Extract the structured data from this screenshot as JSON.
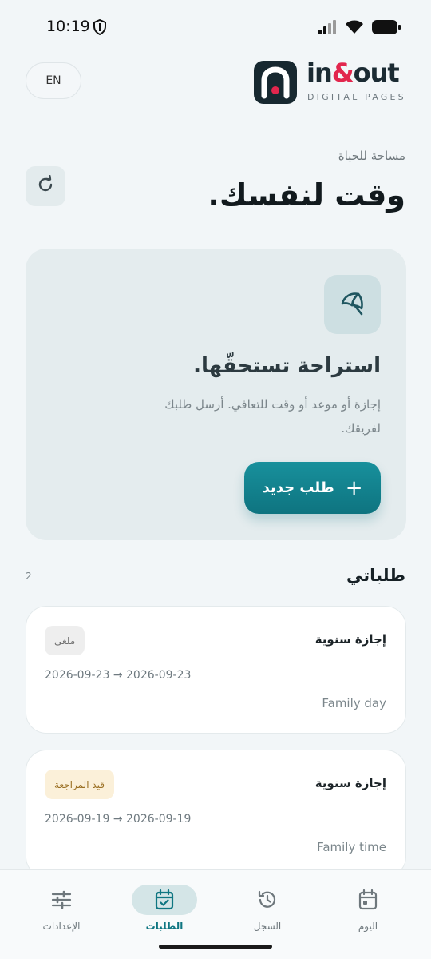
{
  "status": {
    "time": "10:19"
  },
  "header": {
    "lang_label": "EN",
    "logo_text_a": "in",
    "logo_text_amp": "&",
    "logo_text_b": "out",
    "logo_sub": "DIGITAL PAGES"
  },
  "intro": {
    "eyebrow": "مساحة للحياة",
    "title": "وقت لنفسك."
  },
  "hero": {
    "title": "استراحة تستحقّها.",
    "description": "إجازة أو موعد أو وقت للتعافي. أرسل طلبك لفريقك.",
    "button_label": "طلب جديد",
    "button_icon": "+"
  },
  "requests": {
    "title": "طلباتي",
    "count": "2",
    "items": [
      {
        "type": "إجازة سنوية",
        "status": "ملغى",
        "start": "2026-09-23",
        "end": "2026-09-23",
        "arrow": "→",
        "note": "Family day"
      },
      {
        "type": "إجازة سنوية",
        "status": "قيد المراجعة",
        "start": "2026-09-19",
        "end": "2026-09-19",
        "arrow": "→",
        "note": "Family time"
      }
    ]
  },
  "nav": {
    "today": "اليوم",
    "history": "السجل",
    "requests": "الطلبات",
    "settings": "الإعدادات"
  },
  "colors": {
    "accent": "#0f7682",
    "brand_red": "#e2264d",
    "pending_bg": "#fbf0d9",
    "cancelled_bg": "#eeeeee"
  }
}
